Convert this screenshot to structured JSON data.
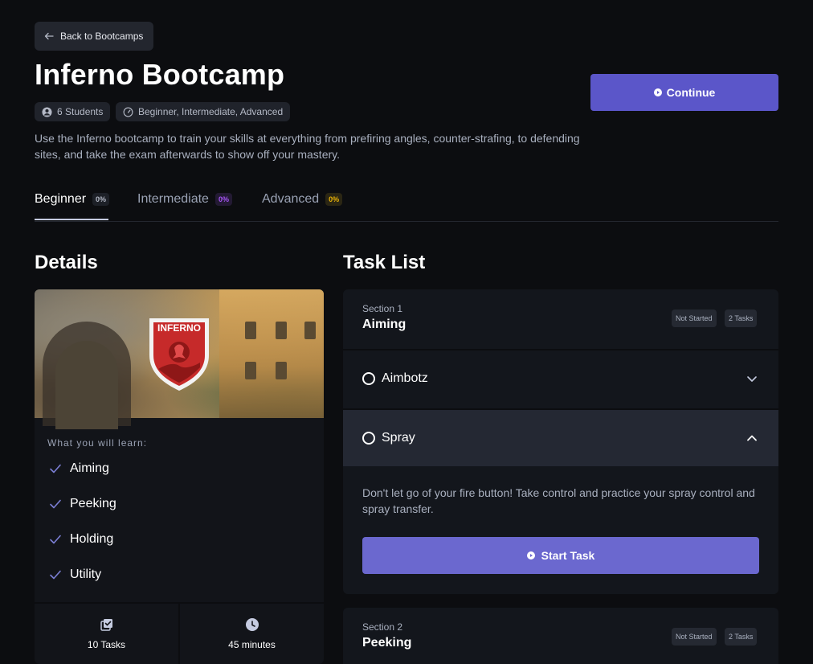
{
  "header": {
    "back_label": "Back to Bootcamps",
    "title": "Inferno Bootcamp",
    "students_badge": "6 Students",
    "levels_badge": "Beginner, Intermediate, Advanced",
    "description": "Use the Inferno bootcamp to train your skills at everything from prefiring angles, counter-strafing, to defending sites, and take the exam afterwards to show off your mastery.",
    "continue_label": "Continue"
  },
  "tabs": [
    {
      "label": "Beginner",
      "progress": "0%",
      "pill_color": "#b4b9c6",
      "active": true
    },
    {
      "label": "Intermediate",
      "progress": "0%",
      "pill_color": "#a855f7",
      "active": false
    },
    {
      "label": "Advanced",
      "progress": "0%",
      "pill_color": "#eab308",
      "active": false
    }
  ],
  "details": {
    "heading": "Details",
    "logo_text": "INFERNO",
    "learn_label": "What you will learn:",
    "learn_items": [
      "Aiming",
      "Peeking",
      "Holding",
      "Utility"
    ],
    "stats": {
      "tasks": "10 Tasks",
      "duration": "45 minutes"
    }
  },
  "task_list": {
    "heading": "Task List",
    "sections": [
      {
        "label": "Section 1",
        "name": "Aiming",
        "status": "Not Started",
        "count": "2 Tasks",
        "tasks": [
          {
            "name": "Aimbotz",
            "expanded": false
          },
          {
            "name": "Spray",
            "expanded": true,
            "description": "Don't let go of your fire button! Take control and practice your spray control and spray transfer.",
            "start_label": "Start Task"
          }
        ]
      },
      {
        "label": "Section 2",
        "name": "Peeking",
        "status": "Not Started",
        "count": "2 Tasks"
      }
    ]
  },
  "colors": {
    "accent": "#5b56c9",
    "accent_light": "#6b68cf",
    "background": "#0c0d10",
    "card": "#13161c"
  }
}
